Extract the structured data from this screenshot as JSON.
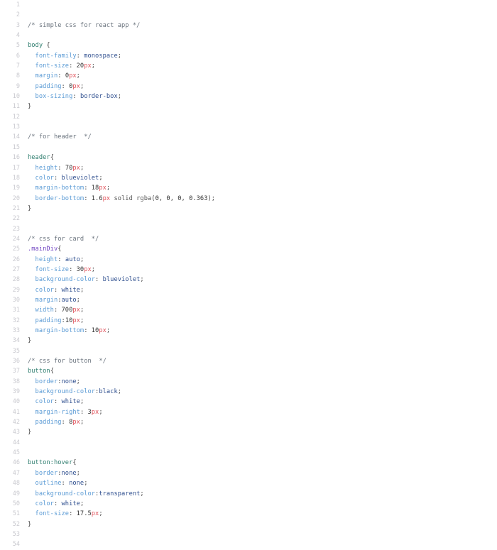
{
  "editor": {
    "language": "css",
    "filetype": "CSS stylesheet",
    "background_color": "#ffffff",
    "gutter_color": "#c9c9cf",
    "first_line": 1,
    "last_line": 54,
    "total_lines": 54,
    "theme_colors": {
      "comment": "#6a737d",
      "element_selector": "#2e7d6e",
      "class_selector": "#6f42c1",
      "property": "#5b9bd5",
      "value": "#2f4f8f",
      "number": "#333333",
      "unit": "#e0525b",
      "punctuation": "#444444"
    }
  },
  "lines": [
    {
      "n": "1",
      "tokens": []
    },
    {
      "n": "2",
      "tokens": []
    },
    {
      "n": "3",
      "tokens": [
        {
          "t": "comment",
          "v": "/* simple css for react app */"
        }
      ]
    },
    {
      "n": "4",
      "tokens": []
    },
    {
      "n": "5",
      "tokens": [
        {
          "t": "sel-el",
          "v": "body"
        },
        {
          "t": "punc",
          "v": " {"
        }
      ]
    },
    {
      "n": "6",
      "tokens": [
        {
          "t": "prop",
          "v": "  font-family"
        },
        {
          "t": "punc",
          "v": ": "
        },
        {
          "t": "val",
          "v": "monospace"
        },
        {
          "t": "punc",
          "v": ";"
        }
      ]
    },
    {
      "n": "7",
      "tokens": [
        {
          "t": "prop",
          "v": "  font-size"
        },
        {
          "t": "punc",
          "v": ": "
        },
        {
          "t": "num",
          "v": "20"
        },
        {
          "t": "unit",
          "v": "px"
        },
        {
          "t": "punc",
          "v": ";"
        }
      ]
    },
    {
      "n": "8",
      "tokens": [
        {
          "t": "prop",
          "v": "  margin"
        },
        {
          "t": "punc",
          "v": ": "
        },
        {
          "t": "num",
          "v": "0"
        },
        {
          "t": "unit",
          "v": "px"
        },
        {
          "t": "punc",
          "v": ";"
        }
      ]
    },
    {
      "n": "9",
      "tokens": [
        {
          "t": "prop",
          "v": "  padding"
        },
        {
          "t": "punc",
          "v": ": "
        },
        {
          "t": "num",
          "v": "0"
        },
        {
          "t": "unit",
          "v": "px"
        },
        {
          "t": "punc",
          "v": ";"
        }
      ]
    },
    {
      "n": "10",
      "tokens": [
        {
          "t": "prop",
          "v": "  box-sizing"
        },
        {
          "t": "punc",
          "v": ": "
        },
        {
          "t": "val",
          "v": "border-box"
        },
        {
          "t": "punc",
          "v": ";"
        }
      ]
    },
    {
      "n": "11",
      "tokens": [
        {
          "t": "punc",
          "v": "}"
        }
      ]
    },
    {
      "n": "12",
      "tokens": []
    },
    {
      "n": "13",
      "tokens": []
    },
    {
      "n": "14",
      "tokens": [
        {
          "t": "comment",
          "v": "/* for header  */"
        }
      ]
    },
    {
      "n": "15",
      "tokens": []
    },
    {
      "n": "16",
      "tokens": [
        {
          "t": "sel-el",
          "v": "header"
        },
        {
          "t": "punc",
          "v": "{"
        }
      ]
    },
    {
      "n": "17",
      "tokens": [
        {
          "t": "prop",
          "v": "  height"
        },
        {
          "t": "punc",
          "v": ": "
        },
        {
          "t": "num",
          "v": "70"
        },
        {
          "t": "unit",
          "v": "px"
        },
        {
          "t": "punc",
          "v": ";"
        }
      ]
    },
    {
      "n": "18",
      "tokens": [
        {
          "t": "prop",
          "v": "  color"
        },
        {
          "t": "punc",
          "v": ": "
        },
        {
          "t": "val",
          "v": "blueviolet"
        },
        {
          "t": "punc",
          "v": ";"
        }
      ]
    },
    {
      "n": "19",
      "tokens": [
        {
          "t": "prop",
          "v": "  margin-bottom"
        },
        {
          "t": "punc",
          "v": ": "
        },
        {
          "t": "num",
          "v": "18"
        },
        {
          "t": "unit",
          "v": "px"
        },
        {
          "t": "punc",
          "v": ";"
        }
      ]
    },
    {
      "n": "20",
      "tokens": [
        {
          "t": "prop",
          "v": "  border-bottom"
        },
        {
          "t": "punc",
          "v": ": "
        },
        {
          "t": "num",
          "v": "1.6"
        },
        {
          "t": "unit",
          "v": "px"
        },
        {
          "t": "func",
          "v": " solid rgba"
        },
        {
          "t": "punc",
          "v": "("
        },
        {
          "t": "num",
          "v": "0"
        },
        {
          "t": "punc",
          "v": ", "
        },
        {
          "t": "num",
          "v": "0"
        },
        {
          "t": "punc",
          "v": ", "
        },
        {
          "t": "num",
          "v": "0"
        },
        {
          "t": "punc",
          "v": ", "
        },
        {
          "t": "num",
          "v": "0.363"
        },
        {
          "t": "punc",
          "v": ");"
        }
      ]
    },
    {
      "n": "21",
      "tokens": [
        {
          "t": "punc",
          "v": "}"
        }
      ]
    },
    {
      "n": "22",
      "tokens": []
    },
    {
      "n": "23",
      "tokens": []
    },
    {
      "n": "24",
      "tokens": [
        {
          "t": "comment",
          "v": "/* css for card  */"
        }
      ]
    },
    {
      "n": "25",
      "tokens": [
        {
          "t": "sel-cls",
          "v": ".mainDiv"
        },
        {
          "t": "punc",
          "v": "{"
        }
      ]
    },
    {
      "n": "26",
      "tokens": [
        {
          "t": "prop",
          "v": "  height"
        },
        {
          "t": "punc",
          "v": ": "
        },
        {
          "t": "val",
          "v": "auto"
        },
        {
          "t": "punc",
          "v": ";"
        }
      ]
    },
    {
      "n": "27",
      "tokens": [
        {
          "t": "prop",
          "v": "  font-size"
        },
        {
          "t": "punc",
          "v": ": "
        },
        {
          "t": "num",
          "v": "30"
        },
        {
          "t": "unit",
          "v": "px"
        },
        {
          "t": "punc",
          "v": ";"
        }
      ]
    },
    {
      "n": "28",
      "tokens": [
        {
          "t": "prop",
          "v": "  background-color"
        },
        {
          "t": "punc",
          "v": ": "
        },
        {
          "t": "val",
          "v": "blueviolet"
        },
        {
          "t": "punc",
          "v": ";"
        }
      ]
    },
    {
      "n": "29",
      "tokens": [
        {
          "t": "prop",
          "v": "  color"
        },
        {
          "t": "punc",
          "v": ": "
        },
        {
          "t": "val",
          "v": "white"
        },
        {
          "t": "punc",
          "v": ";"
        }
      ]
    },
    {
      "n": "30",
      "tokens": [
        {
          "t": "prop",
          "v": "  margin"
        },
        {
          "t": "punc",
          "v": ":"
        },
        {
          "t": "val",
          "v": "auto"
        },
        {
          "t": "punc",
          "v": ";"
        }
      ]
    },
    {
      "n": "31",
      "tokens": [
        {
          "t": "prop",
          "v": "  width"
        },
        {
          "t": "punc",
          "v": ": "
        },
        {
          "t": "num",
          "v": "700"
        },
        {
          "t": "unit",
          "v": "px"
        },
        {
          "t": "punc",
          "v": ";"
        }
      ]
    },
    {
      "n": "32",
      "tokens": [
        {
          "t": "prop",
          "v": "  padding"
        },
        {
          "t": "punc",
          "v": ":"
        },
        {
          "t": "num",
          "v": "10"
        },
        {
          "t": "unit",
          "v": "px"
        },
        {
          "t": "punc",
          "v": ";"
        }
      ]
    },
    {
      "n": "33",
      "tokens": [
        {
          "t": "prop",
          "v": "  margin-bottom"
        },
        {
          "t": "punc",
          "v": ": "
        },
        {
          "t": "num",
          "v": "10"
        },
        {
          "t": "unit",
          "v": "px"
        },
        {
          "t": "punc",
          "v": ";"
        }
      ]
    },
    {
      "n": "34",
      "tokens": [
        {
          "t": "punc",
          "v": "}"
        }
      ]
    },
    {
      "n": "35",
      "tokens": []
    },
    {
      "n": "36",
      "tokens": [
        {
          "t": "comment",
          "v": "/* css for button  */"
        }
      ]
    },
    {
      "n": "37",
      "tokens": [
        {
          "t": "sel-el",
          "v": "button"
        },
        {
          "t": "punc",
          "v": "{"
        }
      ]
    },
    {
      "n": "38",
      "tokens": [
        {
          "t": "prop",
          "v": "  border"
        },
        {
          "t": "punc",
          "v": ":"
        },
        {
          "t": "val",
          "v": "none"
        },
        {
          "t": "punc",
          "v": ";"
        }
      ]
    },
    {
      "n": "39",
      "tokens": [
        {
          "t": "prop",
          "v": "  background-color"
        },
        {
          "t": "punc",
          "v": ":"
        },
        {
          "t": "val",
          "v": "black"
        },
        {
          "t": "punc",
          "v": ";"
        }
      ]
    },
    {
      "n": "40",
      "tokens": [
        {
          "t": "prop",
          "v": "  color"
        },
        {
          "t": "punc",
          "v": ": "
        },
        {
          "t": "val",
          "v": "white"
        },
        {
          "t": "punc",
          "v": ";"
        }
      ]
    },
    {
      "n": "41",
      "tokens": [
        {
          "t": "prop",
          "v": "  margin-right"
        },
        {
          "t": "punc",
          "v": ": "
        },
        {
          "t": "num",
          "v": "3"
        },
        {
          "t": "unit",
          "v": "px"
        },
        {
          "t": "punc",
          "v": ";"
        }
      ]
    },
    {
      "n": "42",
      "tokens": [
        {
          "t": "prop",
          "v": "  padding"
        },
        {
          "t": "punc",
          "v": ": "
        },
        {
          "t": "num",
          "v": "8"
        },
        {
          "t": "unit",
          "v": "px"
        },
        {
          "t": "punc",
          "v": ";"
        }
      ]
    },
    {
      "n": "43",
      "tokens": [
        {
          "t": "punc",
          "v": "}"
        }
      ]
    },
    {
      "n": "44",
      "tokens": []
    },
    {
      "n": "45",
      "tokens": []
    },
    {
      "n": "46",
      "tokens": [
        {
          "t": "sel-el",
          "v": "button:hover"
        },
        {
          "t": "punc",
          "v": "{"
        }
      ]
    },
    {
      "n": "47",
      "tokens": [
        {
          "t": "prop",
          "v": "  border"
        },
        {
          "t": "punc",
          "v": ":"
        },
        {
          "t": "val",
          "v": "none"
        },
        {
          "t": "punc",
          "v": ";"
        }
      ]
    },
    {
      "n": "48",
      "tokens": [
        {
          "t": "prop",
          "v": "  outline"
        },
        {
          "t": "punc",
          "v": ": "
        },
        {
          "t": "val",
          "v": "none"
        },
        {
          "t": "punc",
          "v": ";"
        }
      ]
    },
    {
      "n": "49",
      "tokens": [
        {
          "t": "prop",
          "v": "  background-color"
        },
        {
          "t": "punc",
          "v": ":"
        },
        {
          "t": "val",
          "v": "transparent"
        },
        {
          "t": "punc",
          "v": ";"
        }
      ]
    },
    {
      "n": "50",
      "tokens": [
        {
          "t": "prop",
          "v": "  color"
        },
        {
          "t": "punc",
          "v": ": "
        },
        {
          "t": "val",
          "v": "white"
        },
        {
          "t": "punc",
          "v": ";"
        }
      ]
    },
    {
      "n": "51",
      "tokens": [
        {
          "t": "prop",
          "v": "  font-size"
        },
        {
          "t": "punc",
          "v": ": "
        },
        {
          "t": "num",
          "v": "17.5"
        },
        {
          "t": "unit",
          "v": "px"
        },
        {
          "t": "punc",
          "v": ";"
        }
      ]
    },
    {
      "n": "52",
      "tokens": [
        {
          "t": "punc",
          "v": "}"
        }
      ]
    },
    {
      "n": "53",
      "tokens": []
    },
    {
      "n": "54",
      "tokens": []
    }
  ]
}
